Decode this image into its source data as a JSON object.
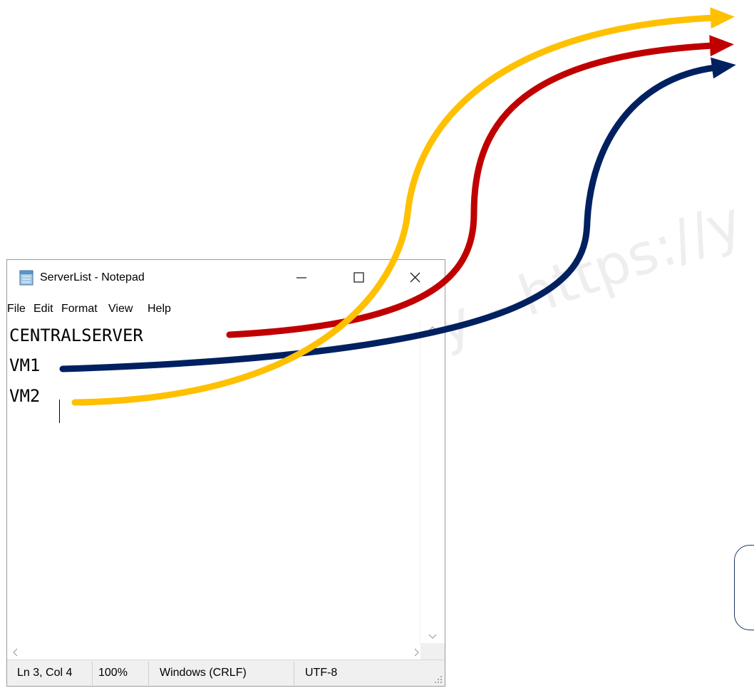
{
  "window": {
    "title": "ServerList - Notepad",
    "controls": {
      "minimize": "—",
      "maximize": "☐",
      "close": "✕"
    }
  },
  "menu": [
    "File",
    "Edit",
    "Format",
    "View",
    "Help"
  ],
  "editor": {
    "lines": [
      "CENTRALSERVER",
      "VM1",
      "VM2"
    ]
  },
  "status": {
    "position": "Ln 3, Col 4",
    "zoom": "100%",
    "line_ending": "Windows (CRLF)",
    "encoding": "UTF-8"
  },
  "watermark": "y - https://y",
  "colors": {
    "yellow": "#FFC000",
    "red": "#C00000",
    "navy": "#002060"
  },
  "icons": [
    "notepad-icon",
    "minimize-icon",
    "maximize-icon",
    "close-icon",
    "scroll-up-icon",
    "scroll-down-icon",
    "scroll-left-icon",
    "scroll-right-icon",
    "resize-grip-icon"
  ]
}
